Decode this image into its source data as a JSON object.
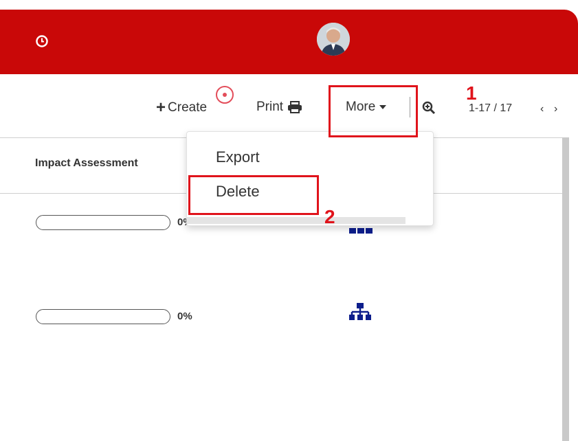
{
  "header": {
    "clock_icon": "clock-icon",
    "avatar_icon": "user-avatar",
    "brand_color": "#c90808"
  },
  "toolbar": {
    "create_label": "Create",
    "print_label": "Print",
    "more_label": "More",
    "zoom_icon": "zoom-in-icon",
    "pagination": "1-17 / 17",
    "prev_icon": "chevron-left-icon",
    "next_icon": "chevron-right-icon"
  },
  "table": {
    "columns": [
      "Impact Assessment"
    ],
    "rows": [
      {
        "progress": 0,
        "percent_label": "0%",
        "icon": "org-chart-icon"
      },
      {
        "progress": 0,
        "percent_label": "0%",
        "icon": "org-chart-icon"
      }
    ]
  },
  "dropdown": {
    "items": [
      "Export",
      "Delete"
    ]
  },
  "annotations": {
    "step1": "1",
    "step2": "2",
    "highlight_color": "#e0131b"
  }
}
